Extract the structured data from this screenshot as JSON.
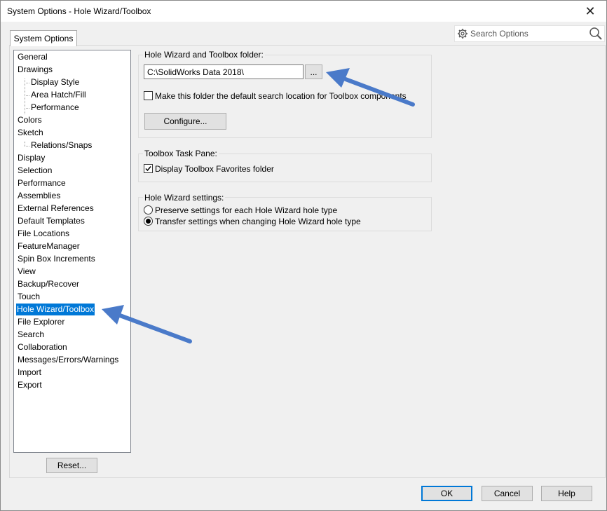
{
  "window": {
    "title": "System Options - Hole Wizard/Toolbox",
    "close_glyph": "✕"
  },
  "tab": {
    "label": "System Options"
  },
  "search": {
    "placeholder": "Search Options",
    "left_icon": "gear-icon",
    "right_icon": "search-icon"
  },
  "tree": {
    "items": [
      {
        "label": "General",
        "indent": 0
      },
      {
        "label": "Drawings",
        "indent": 0
      },
      {
        "label": "Display Style",
        "indent": 1
      },
      {
        "label": "Area Hatch/Fill",
        "indent": 1
      },
      {
        "label": "Performance",
        "indent": 1
      },
      {
        "label": "Colors",
        "indent": 0
      },
      {
        "label": "Sketch",
        "indent": 0
      },
      {
        "label": "Relations/Snaps",
        "indent": 1
      },
      {
        "label": "Display",
        "indent": 0
      },
      {
        "label": "Selection",
        "indent": 0
      },
      {
        "label": "Performance",
        "indent": 0
      },
      {
        "label": "Assemblies",
        "indent": 0
      },
      {
        "label": "External References",
        "indent": 0
      },
      {
        "label": "Default Templates",
        "indent": 0
      },
      {
        "label": "File Locations",
        "indent": 0
      },
      {
        "label": "FeatureManager",
        "indent": 0
      },
      {
        "label": "Spin Box Increments",
        "indent": 0
      },
      {
        "label": "View",
        "indent": 0
      },
      {
        "label": "Backup/Recover",
        "indent": 0
      },
      {
        "label": "Touch",
        "indent": 0
      },
      {
        "label": "Hole Wizard/Toolbox",
        "indent": 0,
        "selected": true
      },
      {
        "label": "File Explorer",
        "indent": 0
      },
      {
        "label": "Search",
        "indent": 0
      },
      {
        "label": "Collaboration",
        "indent": 0
      },
      {
        "label": "Messages/Errors/Warnings",
        "indent": 0
      },
      {
        "label": "Import",
        "indent": 0
      },
      {
        "label": "Export",
        "indent": 0
      }
    ],
    "reset_label": "Reset..."
  },
  "folder_group": {
    "title": "Hole Wizard and Toolbox folder:",
    "path_value": "C:\\SolidWorks Data 2018\\",
    "browse_label": "...",
    "default_search_checkbox": {
      "label": "Make this folder the default search location for Toolbox components",
      "checked": false
    },
    "configure_label": "Configure..."
  },
  "task_pane_group": {
    "title": "Toolbox Task Pane:",
    "favorites_checkbox": {
      "label": "Display Toolbox Favorites folder",
      "checked": true
    }
  },
  "settings_group": {
    "title": "Hole Wizard settings:",
    "options": [
      {
        "label": "Preserve settings for each Hole Wizard hole type",
        "selected": false
      },
      {
        "label": "Transfer settings when changing Hole Wizard hole type",
        "selected": true
      }
    ]
  },
  "footer": {
    "ok_label": "OK",
    "cancel_label": "Cancel",
    "help_label": "Help"
  },
  "colors": {
    "selection": "#0078d7",
    "annotation_arrow": "#4a7ac9"
  }
}
